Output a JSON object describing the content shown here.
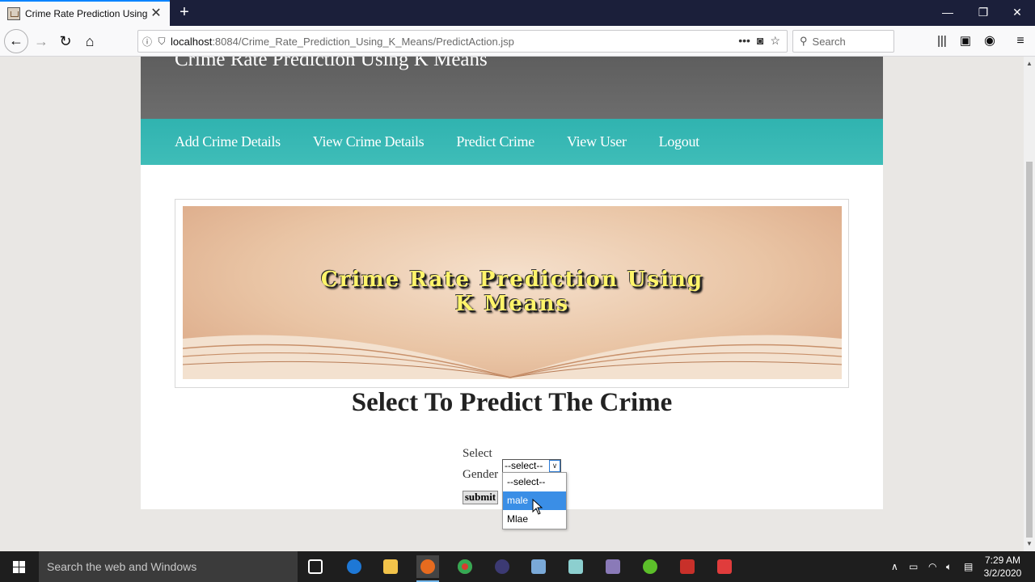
{
  "browser": {
    "tab_title": "Crime Rate Prediction Using K Means",
    "url_host": "localhost",
    "url_rest": ":8084/Crime_Rate_Prediction_Using_K_Means/PredictAction.jsp",
    "search_placeholder": "Search"
  },
  "site": {
    "title": "Crime Rate Prediction Using K Means",
    "nav": [
      {
        "label": "Add Crime Details"
      },
      {
        "label": "View Crime Details"
      },
      {
        "label": "Predict Crime"
      },
      {
        "label": "View User"
      },
      {
        "label": "Logout"
      }
    ],
    "banner_line1": "Crime Rate Prediction Using",
    "banner_line2": "K Means",
    "heading": "Select To Predict The Crime"
  },
  "form": {
    "label_line1": "Select",
    "label_line2": "Gender",
    "selected_value": "--select--",
    "options": [
      {
        "label": "--select--",
        "highlighted": false
      },
      {
        "label": "male",
        "highlighted": true
      },
      {
        "label": "Mlae",
        "highlighted": false
      }
    ],
    "submit_label": "submit"
  },
  "taskbar": {
    "search_placeholder": "Search the web and Windows",
    "time": "7:29 AM",
    "date": "3/2/2020"
  },
  "colors": {
    "nav_teal": "#3ab8b4",
    "header_gray": "#666666",
    "highlight_blue": "#3a8ee6"
  }
}
